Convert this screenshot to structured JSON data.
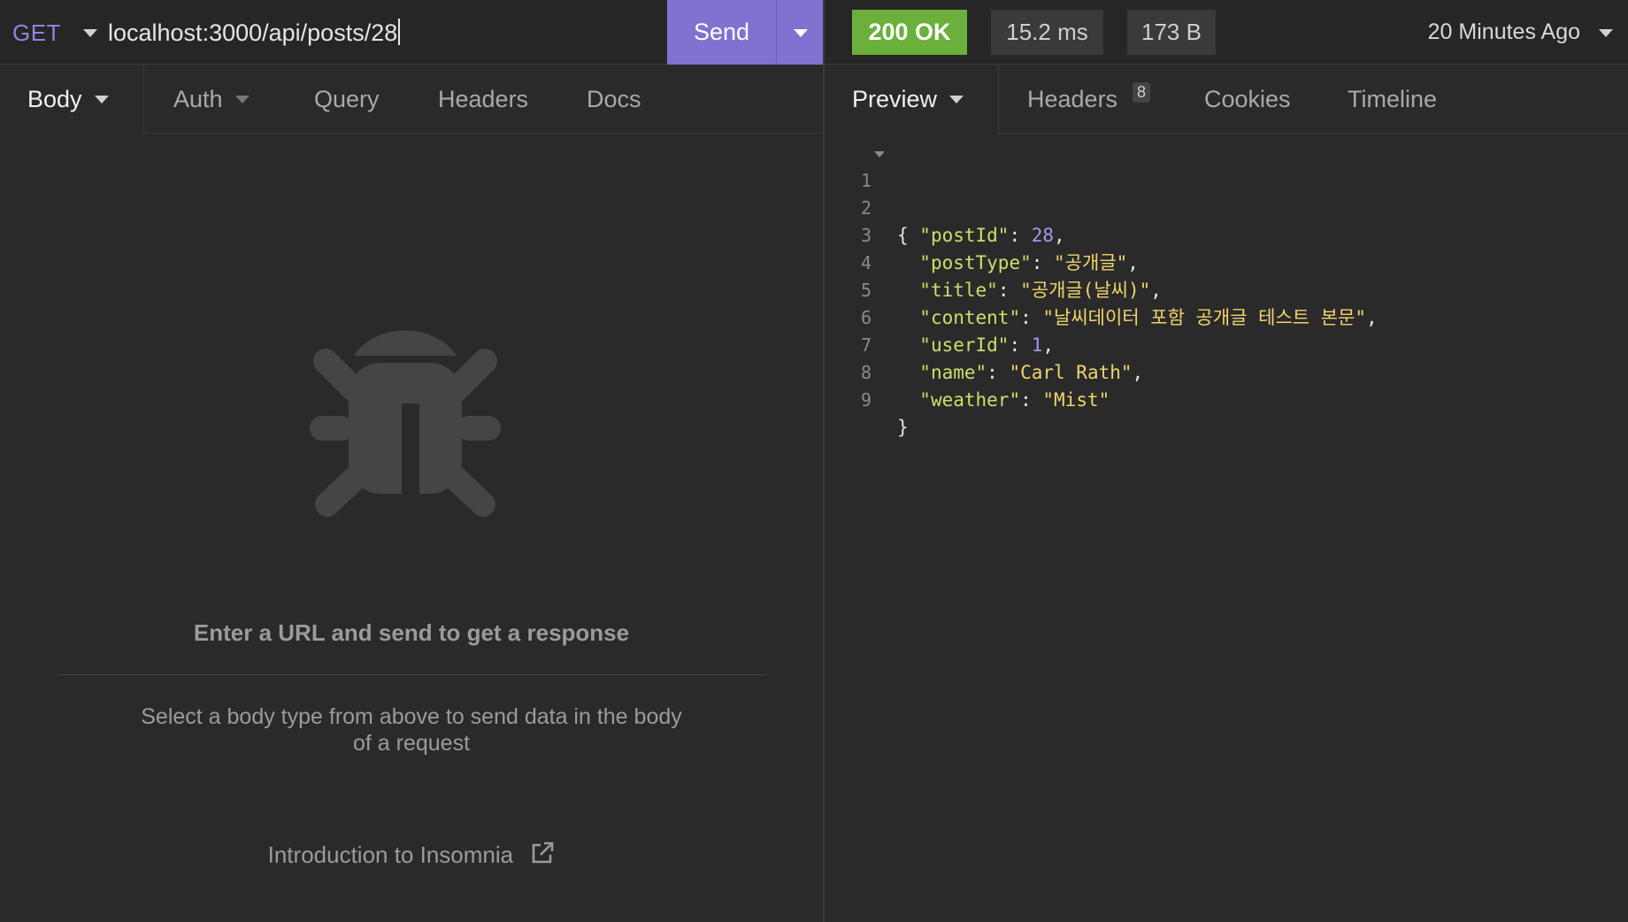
{
  "request": {
    "method": "GET",
    "url": "localhost:3000/api/posts/28",
    "send_label": "Send"
  },
  "response_meta": {
    "status": "200 OK",
    "time": "15.2 ms",
    "size": "173 B",
    "history": "20 Minutes Ago"
  },
  "request_tabs": [
    {
      "label": "Body"
    },
    {
      "label": "Auth"
    },
    {
      "label": "Query"
    },
    {
      "label": "Headers"
    },
    {
      "label": "Docs"
    }
  ],
  "response_tabs": [
    {
      "label": "Preview"
    },
    {
      "label": "Headers",
      "count": "8"
    },
    {
      "label": "Cookies"
    },
    {
      "label": "Timeline"
    }
  ],
  "empty_state": {
    "title": "Enter a URL and send to get a response",
    "description": "Select a body type from above to send data in the body of a request",
    "link": "Introduction to Insomnia"
  },
  "response_body": {
    "line_numbers": [
      "1",
      "2",
      "3",
      "4",
      "5",
      "6",
      "7",
      "8",
      "9"
    ],
    "open_brace": "{",
    "close_brace": "}",
    "fields": [
      {
        "key": "\"postId\"",
        "value": "28",
        "kind": "number"
      },
      {
        "key": "\"postType\"",
        "value": "\"공개글\"",
        "kind": "string"
      },
      {
        "key": "\"title\"",
        "value": "\"공개글(날씨)\"",
        "kind": "string"
      },
      {
        "key": "\"content\"",
        "value": "\"날씨데이터 포함 공개글 테스트 본문\"",
        "kind": "string"
      },
      {
        "key": "\"userId\"",
        "value": "1",
        "kind": "number"
      },
      {
        "key": "\"name\"",
        "value": "\"Carl Rath\"",
        "kind": "string"
      },
      {
        "key": "\"weather\"",
        "value": "\"Mist\"",
        "kind": "string"
      }
    ]
  },
  "colors": {
    "accent": "#7f72d0",
    "status_ok": "#6ab03a",
    "method": "#8f84dc",
    "json_key": "#c9e06a",
    "json_string": "#f0d46c",
    "json_number": "#a895f5"
  }
}
